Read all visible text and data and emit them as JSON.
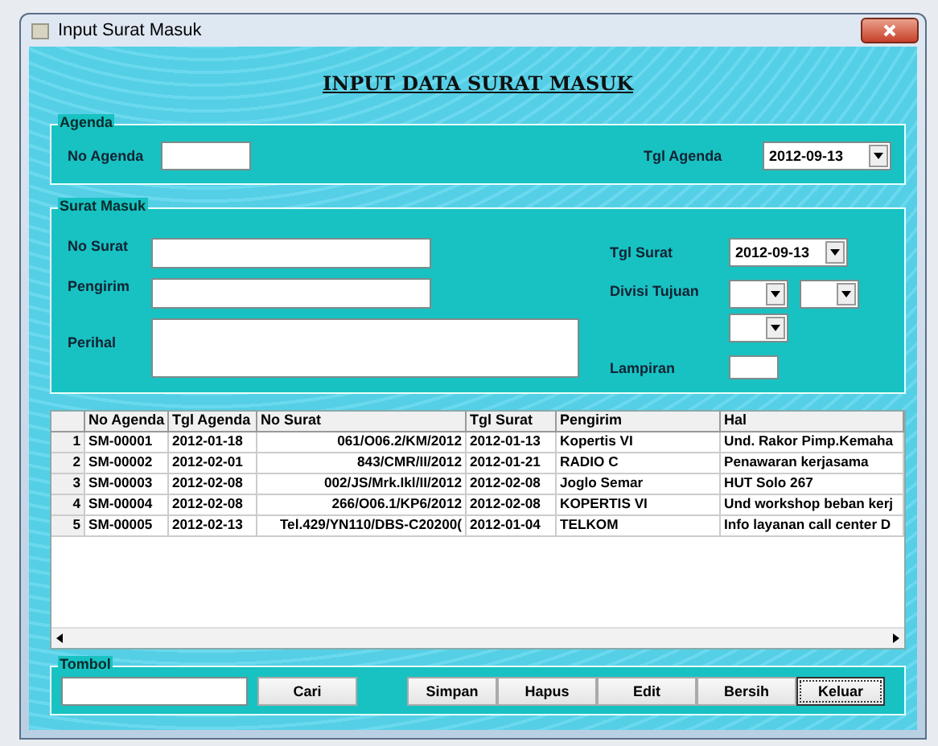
{
  "window": {
    "title": "Input Surat Masuk"
  },
  "heading": "INPUT DATA SURAT MASUK",
  "agenda": {
    "legend": "Agenda",
    "no_agenda_label": "No Agenda",
    "tgl_agenda_label": "Tgl Agenda",
    "tgl_agenda_value": "2012-09-13"
  },
  "surat_masuk": {
    "legend": "Surat Masuk",
    "no_surat_label": "No Surat",
    "pengirim_label": "Pengirim",
    "perihal_label": "Perihal",
    "tgl_surat_label": "Tgl Surat",
    "tgl_surat_value": "2012-09-13",
    "divisi_tujuan_label": "Divisi Tujuan",
    "lampiran_label": "Lampiran"
  },
  "table": {
    "columns": [
      "No Agenda",
      "Tgl Agenda",
      "No Surat",
      "Tgl Surat",
      "Pengirim",
      "Hal"
    ],
    "rows": [
      {
        "index": "1",
        "cells": [
          "SM-00001",
          "2012-01-18",
          "061/O06.2/KM/2012",
          "2012-01-13",
          "Kopertis VI",
          "Und. Rakor Pimp.Kemaha"
        ]
      },
      {
        "index": "2",
        "cells": [
          "SM-00002",
          "2012-02-01",
          "843/CMR/II/2012",
          "2012-01-21",
          "RADIO C",
          "Penawaran kerjasama"
        ]
      },
      {
        "index": "3",
        "cells": [
          "SM-00003",
          "2012-02-08",
          "002/JS/Mrk.Ikl/II/2012",
          "2012-02-08",
          "Joglo Semar",
          "HUT Solo 267"
        ]
      },
      {
        "index": "4",
        "cells": [
          "SM-00004",
          "2012-02-08",
          "266/O06.1/KP6/2012",
          "2012-02-08",
          "KOPERTIS VI",
          "Und workshop beban kerj"
        ]
      },
      {
        "index": "5",
        "cells": [
          "SM-00005",
          "2012-02-13",
          "Tel.429/YN110/DBS-C20200(",
          "2012-01-04",
          "TELKOM",
          "Info layanan call center D"
        ]
      }
    ]
  },
  "tombol": {
    "legend": "Tombol",
    "buttons": [
      {
        "label": "Cari",
        "focused": false
      },
      {
        "label": "Simpan",
        "focused": false
      },
      {
        "label": "Hapus",
        "focused": false
      },
      {
        "label": "Edit",
        "focused": false
      },
      {
        "label": "Bersih",
        "focused": false
      },
      {
        "label": "Keluar",
        "focused": true
      }
    ]
  }
}
